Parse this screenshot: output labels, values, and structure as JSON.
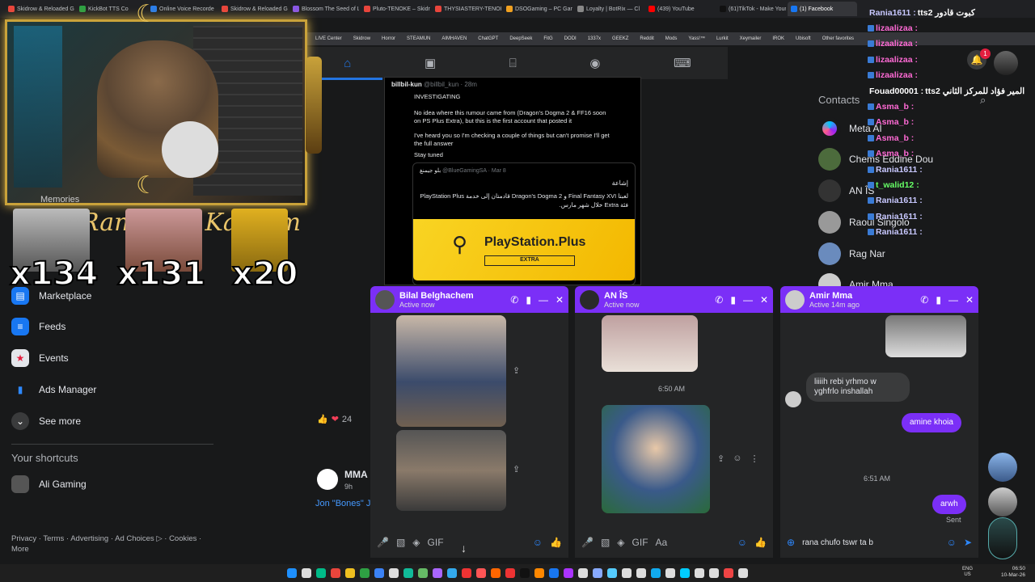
{
  "browser": {
    "tabs": [
      "Skidrow & Reloaded G",
      "KickBot TTS Co",
      "Online Voice Recorde",
      "Skidrow & Reloaded G",
      "Blossom The Seed of L",
      "Pluto-TENOKE – Skidro",
      "THYSIASTERY-TENOKE",
      "DSOGaming – PC Gam",
      "Loyalty | BotRix — Cl",
      "(439) YouTube",
      "(61)TikTok - Make Your",
      "(1) Facebook"
    ],
    "active_tab": "(1) Facebook",
    "bookmarks": [
      "LIVE Center",
      "Skidrow",
      "Horror",
      "STEAMUN",
      "AIMHAVEN",
      "ChatGPT",
      "DeepSeek",
      "FitG",
      "DODI",
      "1337x",
      "GEEKZ",
      "Reddit",
      "Mods",
      "Yass!™",
      "Lurkit",
      "Xeymailer",
      "IROK",
      "Ubisoft",
      "Other favorites"
    ]
  },
  "stream": {
    "memories_label": "Memories",
    "overlay_text": "Ramadan Kareem",
    "emote_counts": [
      "x134",
      "x131",
      "x20"
    ]
  },
  "sidebar": {
    "items": [
      {
        "label": "Marketplace",
        "icon": "marketplace-icon"
      },
      {
        "label": "Feeds",
        "icon": "feeds-icon"
      },
      {
        "label": "Events",
        "icon": "events-icon"
      },
      {
        "label": "Ads Manager",
        "icon": "ads-manager-icon"
      },
      {
        "label": "See more",
        "icon": "chevron-down-icon"
      }
    ],
    "shortcuts_title": "Your shortcuts",
    "shortcut": "Ali Gaming",
    "footer": "Privacy · Terms · Advertising · Ad Choices ▷ · Cookies · More"
  },
  "post": {
    "author": "billbil-kun",
    "handle": "@billbil_kun · 28m",
    "tag": "INVESTIGATING",
    "line1": "No idea where this rumour came from (Dragon's Dogma 2 & FF16 soon on PS Plus Extra), but this is the first account that posted it",
    "line2": "I've heard you so I'm checking a couple of things but can't promise I'll get the full answer",
    "line3": "Stay tuned",
    "quote_author": "بلو جيمنغ",
    "quote_handle": "@BlueGamingSA · Mar 8",
    "quote_tag": "إشاعة",
    "quote_text": "لعبتا Final Fantasy XVI و Dragon's Dogma 2 قادمتان إلى خدمة PlayStation Plus فئة Extra خلال شهر مارس.",
    "ps_title": "PlayStation.Plus",
    "ps_tier": "EXTRA",
    "reaction_count": "24",
    "next_author": "MMA",
    "next_time": "9h",
    "next_text": "Jon \"Bones\" J"
  },
  "contacts": {
    "title": "Contacts",
    "items": [
      "Meta AI",
      "Chems Eddine Dou",
      "AN ÎS",
      "Raoul Singolo",
      "Rag Nar",
      "Amir Mma"
    ]
  },
  "twitch_chat": [
    {
      "user": "Rania1611",
      "msg": "tts2 كبوت قادور",
      "color": "#c8c8ff"
    },
    {
      "user": "lizaalizaa",
      "msg": "",
      "color": "#ff6ad5"
    },
    {
      "user": "lizaalizaa",
      "msg": "",
      "color": "#ff6ad5"
    },
    {
      "user": "lizaalizaa",
      "msg": "",
      "color": "#ff6ad5"
    },
    {
      "user": "lizaalizaa",
      "msg": "",
      "color": "#ff6ad5"
    },
    {
      "user": "Fouad00001",
      "msg": "tts2 المير فؤاد للمركز الثاني",
      "color": "#ffffff"
    },
    {
      "user": "Asma_b",
      "msg": "",
      "color": "#ff6ad5"
    },
    {
      "user": "Asma_b",
      "msg": "",
      "color": "#ff6ad5"
    },
    {
      "user": "Asma_b",
      "msg": "",
      "color": "#ff6ad5"
    },
    {
      "user": "Asma_b",
      "msg": "",
      "color": "#ff6ad5"
    },
    {
      "user": "Rania1611",
      "msg": "",
      "color": "#c8c8ff"
    },
    {
      "user": "t_walid12",
      "msg": "",
      "color": "#66ff66"
    },
    {
      "user": "Rania1611",
      "msg": "",
      "color": "#c8c8ff"
    },
    {
      "user": "Rania1611",
      "msg": "",
      "color": "#c8c8ff"
    },
    {
      "user": "Rania1611",
      "msg": "",
      "color": "#c8c8ff"
    }
  ],
  "chats": [
    {
      "name": "Bilal Belghachem",
      "status": "Active now",
      "composer": ""
    },
    {
      "name": "AN ÎS",
      "status": "Active now",
      "time": "6:50 AM",
      "composer": "Aa"
    },
    {
      "name": "Amir Mma",
      "status": "Active 14m ago",
      "msg_in": "liiiih rebi yrhmo w yghfrlo inshallah",
      "msg_out": "amine khoia",
      "time": "6:51 AM",
      "msg_last": "arwh",
      "sent": "Sent",
      "composer": "rana chufo tswr ta b"
    }
  ],
  "notification_count": "1",
  "clock": {
    "lang": "ENG",
    "region": "US",
    "time": "06:50",
    "date": "10-Mar-26"
  },
  "colors": {
    "accent": "#2374e1",
    "chat_header": "#7b2ff7",
    "gold": "#c9a23a"
  }
}
